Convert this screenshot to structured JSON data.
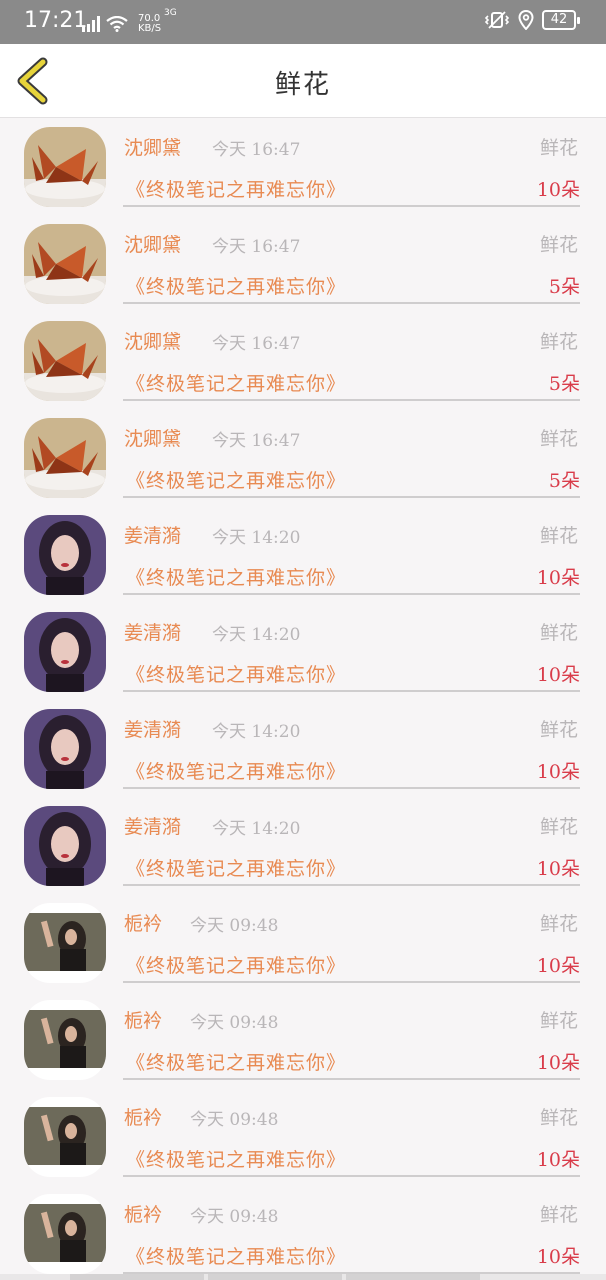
{
  "status_bar": {
    "time": "17:21",
    "network": "3G",
    "speed_value": "70.0",
    "speed_unit": "KB/S",
    "battery": "42",
    "icons": [
      "signal-icon",
      "wifi-icon",
      "vibrate-icon",
      "location-icon",
      "battery-icon"
    ]
  },
  "header": {
    "title": "鲜花",
    "back_icon": "chevron-left-icon",
    "accent_color": "#e7d43a"
  },
  "colors": {
    "sender": "#e88a52",
    "book": "#e88a52",
    "quantity": "#d93c4a",
    "muted": "#b9b6b8"
  },
  "records": [
    {
      "avatar": "paper-crane",
      "sender": "沈卿黛",
      "time": "今天 16:47",
      "gift_type": "鲜花",
      "book": "《终极笔记之再难忘你》",
      "quantity": "10朵"
    },
    {
      "avatar": "paper-crane",
      "sender": "沈卿黛",
      "time": "今天 16:47",
      "gift_type": "鲜花",
      "book": "《终极笔记之再难忘你》",
      "quantity": "5朵"
    },
    {
      "avatar": "paper-crane",
      "sender": "沈卿黛",
      "time": "今天 16:47",
      "gift_type": "鲜花",
      "book": "《终极笔记之再难忘你》",
      "quantity": "5朵"
    },
    {
      "avatar": "paper-crane",
      "sender": "沈卿黛",
      "time": "今天 16:47",
      "gift_type": "鲜花",
      "book": "《终极笔记之再难忘你》",
      "quantity": "5朵"
    },
    {
      "avatar": "portrait-purple",
      "sender": "姜清漪",
      "time": "今天 14:20",
      "gift_type": "鲜花",
      "book": "《终极笔记之再难忘你》",
      "quantity": "10朵"
    },
    {
      "avatar": "portrait-purple",
      "sender": "姜清漪",
      "time": "今天 14:20",
      "gift_type": "鲜花",
      "book": "《终极笔记之再难忘你》",
      "quantity": "10朵"
    },
    {
      "avatar": "portrait-purple",
      "sender": "姜清漪",
      "time": "今天 14:20",
      "gift_type": "鲜花",
      "book": "《终极笔记之再难忘你》",
      "quantity": "10朵"
    },
    {
      "avatar": "portrait-purple",
      "sender": "姜清漪",
      "time": "今天 14:20",
      "gift_type": "鲜花",
      "book": "《终极笔记之再难忘你》",
      "quantity": "10朵"
    },
    {
      "avatar": "portrait-dark",
      "sender": "栀衿",
      "time": "今天 09:48",
      "gift_type": "鲜花",
      "book": "《终极笔记之再难忘你》",
      "quantity": "10朵"
    },
    {
      "avatar": "portrait-dark",
      "sender": "栀衿",
      "time": "今天 09:48",
      "gift_type": "鲜花",
      "book": "《终极笔记之再难忘你》",
      "quantity": "10朵"
    },
    {
      "avatar": "portrait-dark",
      "sender": "栀衿",
      "time": "今天 09:48",
      "gift_type": "鲜花",
      "book": "《终极笔记之再难忘你》",
      "quantity": "10朵"
    },
    {
      "avatar": "portrait-dark",
      "sender": "栀衿",
      "time": "今天 09:48",
      "gift_type": "鲜花",
      "book": "《终极笔记之再难忘你》",
      "quantity": "10朵"
    }
  ]
}
